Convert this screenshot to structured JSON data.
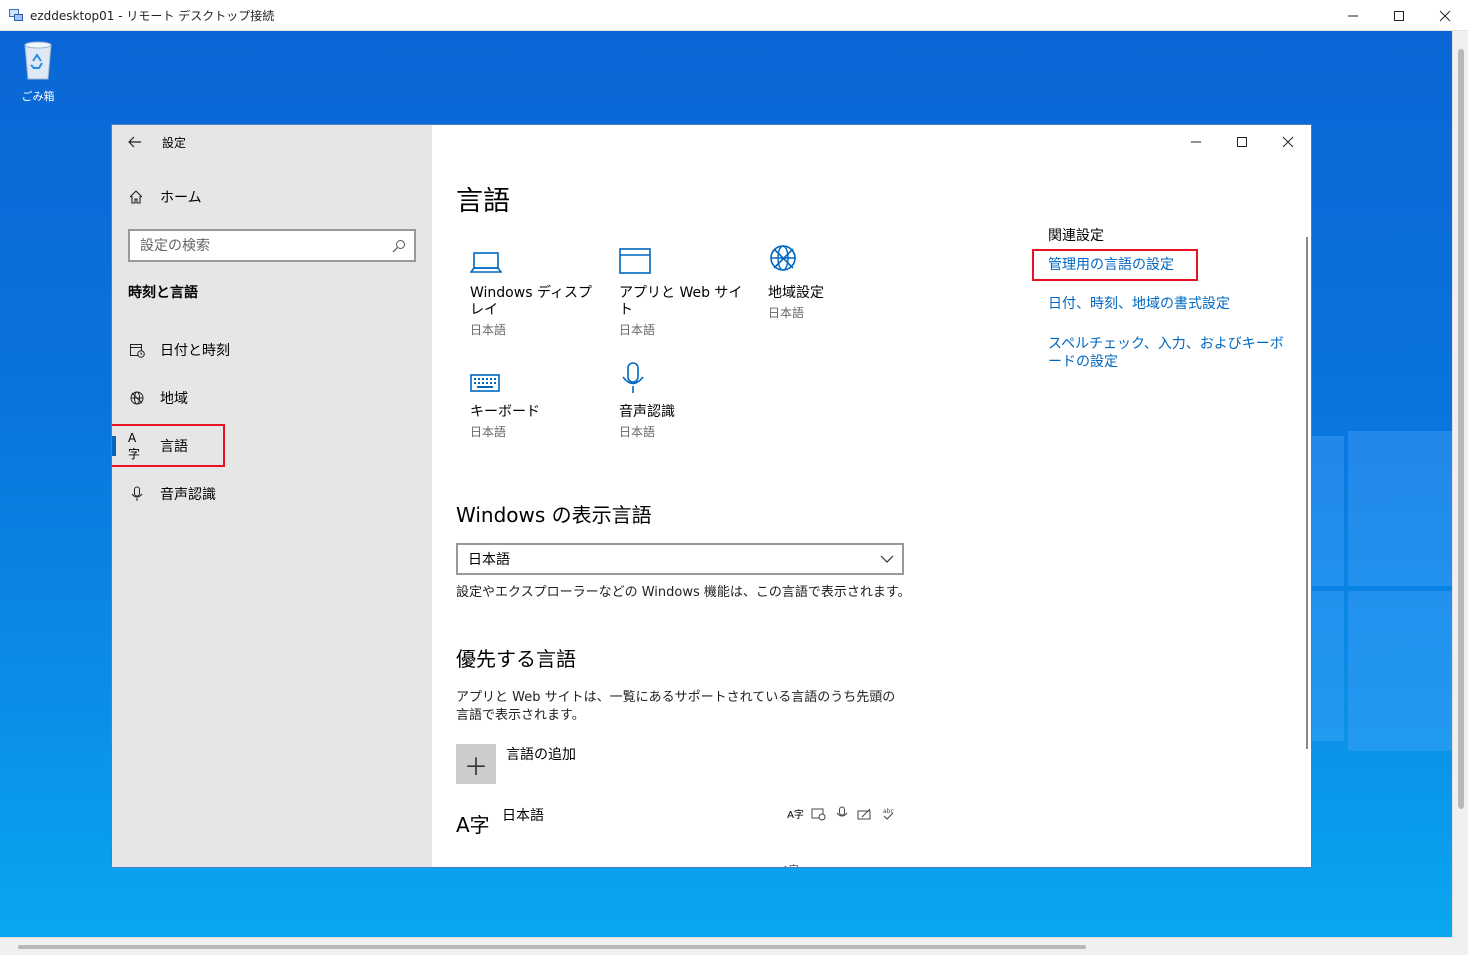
{
  "rdp": {
    "title": "ezddesktop01 - リモート デスクトップ接続"
  },
  "desktop": {
    "recycle_bin_label": "ごみ箱"
  },
  "settings": {
    "window_title": "設定",
    "home_label": "ホーム",
    "search_placeholder": "設定の検索",
    "section_title": "時刻と言語",
    "nav": [
      {
        "label": "日付と時刻",
        "icon": "calendar-clock-icon"
      },
      {
        "label": "地域",
        "icon": "globe-icon"
      },
      {
        "label": "言語",
        "icon": "language-icon",
        "selected": true
      },
      {
        "label": "音声認識",
        "icon": "microphone-icon"
      }
    ],
    "page_title": "言語",
    "tiles": [
      {
        "label": "Windows ディスプレイ",
        "sub": "日本語",
        "icon": "laptop-icon"
      },
      {
        "label": "アプリと Web サイト",
        "sub": "日本語",
        "icon": "window-icon"
      },
      {
        "label": "地域設定",
        "sub": "日本語",
        "icon": "globe-icon"
      },
      {
        "label": "キーボード",
        "sub": "日本語",
        "icon": "keyboard-icon"
      },
      {
        "label": "音声認識",
        "sub": "日本語",
        "icon": "microphone-icon"
      }
    ],
    "display_language": {
      "heading": "Windows の表示言語",
      "selected": "日本語",
      "description": "設定やエクスプローラーなどの Windows 機能は、この言語で表示されます。"
    },
    "preferred": {
      "heading": "優先する言語",
      "description": "アプリと Web サイトは、一覧にあるサポートされている言語のうち先頭の言語で表示されます。",
      "add_label": "言語の追加",
      "languages": [
        {
          "name": "日本語",
          "glyph": "A字"
        }
      ]
    },
    "related": {
      "heading": "関連設定",
      "links": [
        "管理用の言語の設定",
        "日付、時刻、地域の書式設定",
        "スペルチェック、入力、およびキーボードの設定"
      ]
    }
  },
  "colors": {
    "accent": "#0067c0",
    "highlight": "#e81123"
  }
}
